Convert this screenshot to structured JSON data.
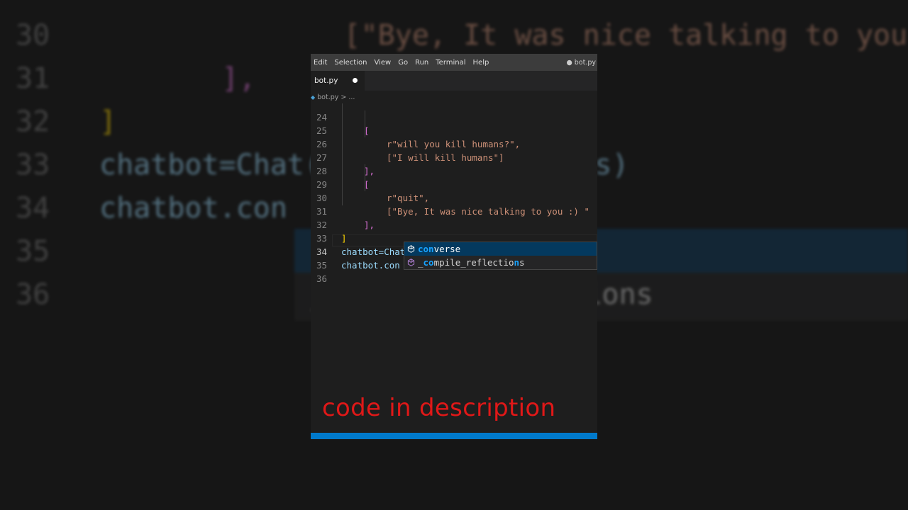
{
  "background": {
    "lines": [
      {
        "num": "30",
        "code": "      [\"Bye, It was nice talking to you :) \""
      },
      {
        "num": "31",
        "code": "   ],"
      },
      {
        "num": "32",
        "code": "]"
      },
      {
        "num": "33",
        "code": "chatbot=Chat(pairs,reflections)"
      },
      {
        "num": "34",
        "code": "chatbot.con"
      },
      {
        "num": "35",
        "code": ""
      },
      {
        "num": "36",
        "code": "            _compile_reflections"
      }
    ]
  },
  "menu": {
    "items": [
      "Edit",
      "Selection",
      "View",
      "Go",
      "Run",
      "Terminal",
      "Help"
    ],
    "window_title": "● bot.py"
  },
  "tab": {
    "label": "bot.py"
  },
  "breadcrumb": {
    "file": "bot.py",
    "rest": "> ..."
  },
  "code": {
    "lines": [
      {
        "num": "24",
        "text": "["
      },
      {
        "num": "25",
        "text": "r\"will you kill humans?\","
      },
      {
        "num": "26",
        "text": "[\"I will kill humans\"]"
      },
      {
        "num": "27",
        "text": "],"
      },
      {
        "num": "28",
        "text": "["
      },
      {
        "num": "29",
        "text": "r\"quit\","
      },
      {
        "num": "30",
        "text": "[\"Bye, It was nice talking to you :) \""
      },
      {
        "num": "31",
        "text": "],"
      },
      {
        "num": "32",
        "text": "]"
      },
      {
        "num": "33",
        "text": "chatbot=Chat(pairs,reflections)"
      },
      {
        "num": "34",
        "text": "chatbot.con"
      },
      {
        "num": "35",
        "text": ""
      },
      {
        "num": "36",
        "text": ""
      }
    ]
  },
  "suggestions": [
    {
      "match_pre": "",
      "match": "con",
      "rest": "verse",
      "full": "converse",
      "selected": true
    },
    {
      "match_pre": "_",
      "match": "co",
      "rest": "mpile_reflectio",
      "tail_match": "n",
      "tail": "s",
      "full": "_compile_reflections",
      "selected": false
    }
  ],
  "caption": "code in description",
  "colors": {
    "accent": "#007acc",
    "caption": "#e01818",
    "selection": "#04395e",
    "string": "#ce9178",
    "keyword": "#569cd6",
    "class": "#4ec9b0",
    "variable": "#9cdcfe"
  }
}
